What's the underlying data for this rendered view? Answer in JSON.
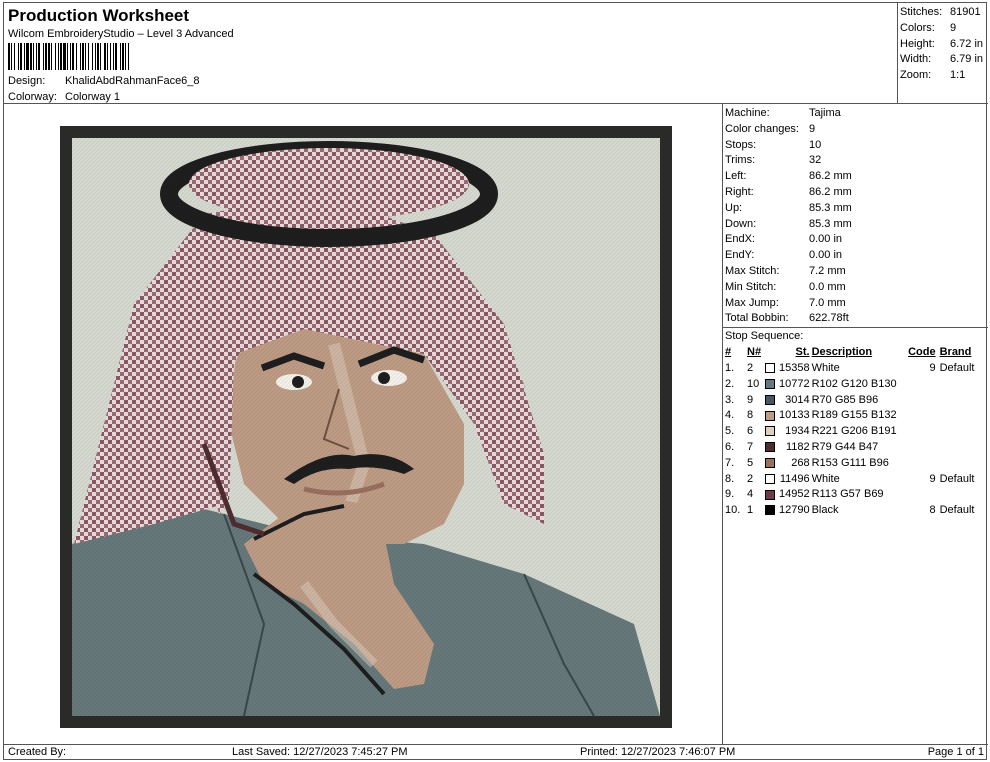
{
  "header": {
    "title": "Production Worksheet",
    "subtitle": "Wilcom EmbroideryStudio – Level 3 Advanced",
    "design_label": "Design:",
    "design_value": "KhalidAbdRahmanFace6_8",
    "colorway_label": "Colorway:",
    "colorway_value": "Colorway 1"
  },
  "stats": [
    {
      "label": "Stitches:",
      "value": "81901"
    },
    {
      "label": "Colors:",
      "value": "9"
    },
    {
      "label": "Height:",
      "value": "6.72 in"
    },
    {
      "label": "Width:",
      "value": "6.79 in"
    },
    {
      "label": "Zoom:",
      "value": "1:1"
    }
  ],
  "machine_info": [
    {
      "label": "Machine:",
      "value": "Tajima"
    },
    {
      "label": "Color changes:",
      "value": "9"
    },
    {
      "label": "Stops:",
      "value": "10"
    },
    {
      "label": "Trims:",
      "value": "32"
    },
    {
      "label": "Left:",
      "value": "86.2 mm"
    },
    {
      "label": "Right:",
      "value": "86.2 mm"
    },
    {
      "label": "Up:",
      "value": "85.3 mm"
    },
    {
      "label": "Down:",
      "value": "85.3 mm"
    },
    {
      "label": "EndX:",
      "value": "0.00 in"
    },
    {
      "label": "EndY:",
      "value": "0.00 in"
    },
    {
      "label": "Max Stitch:",
      "value": "7.2 mm"
    },
    {
      "label": "Min Stitch:",
      "value": "0.0 mm"
    },
    {
      "label": "Max Jump:",
      "value": "7.0 mm"
    },
    {
      "label": "Total Bobbin:",
      "value": "622.78ft"
    }
  ],
  "stop_sequence": {
    "title": "Stop Sequence:",
    "headers": {
      "num": "#",
      "n": "N#",
      "st": "St.",
      "desc": "Description",
      "code": "Code",
      "brand": "Brand"
    },
    "rows": [
      {
        "num": "1.",
        "n": "2",
        "color": "#ffffff",
        "st": "15358",
        "desc": "White",
        "code": "9",
        "brand": "Default"
      },
      {
        "num": "2.",
        "n": "10",
        "color": "#667882",
        "st": "10772",
        "desc": "R102 G120 B130",
        "code": "",
        "brand": ""
      },
      {
        "num": "3.",
        "n": "9",
        "color": "#465560",
        "st": "3014",
        "desc": "R70 G85 B96",
        "code": "",
        "brand": ""
      },
      {
        "num": "4.",
        "n": "8",
        "color": "#bd9b84",
        "st": "10133",
        "desc": "R189 G155 B132",
        "code": "",
        "brand": ""
      },
      {
        "num": "5.",
        "n": "6",
        "color": "#ddcebf",
        "st": "1934",
        "desc": "R221 G206 B191",
        "code": "",
        "brand": ""
      },
      {
        "num": "6.",
        "n": "7",
        "color": "#4f2c2f",
        "st": "1182",
        "desc": "R79 G44 B47",
        "code": "",
        "brand": ""
      },
      {
        "num": "7.",
        "n": "5",
        "color": "#996f60",
        "st": "268",
        "desc": "R153 G111 B96",
        "code": "",
        "brand": ""
      },
      {
        "num": "8.",
        "n": "2",
        "color": "#ffffff",
        "st": "11496",
        "desc": "White",
        "code": "9",
        "brand": "Default"
      },
      {
        "num": "9.",
        "n": "4",
        "color": "#713945",
        "st": "14952",
        "desc": "R113 G57 B69",
        "code": "",
        "brand": ""
      },
      {
        "num": "10.",
        "n": "1",
        "color": "#000000",
        "st": "12790",
        "desc": "Black",
        "code": "8",
        "brand": "Default"
      }
    ]
  },
  "footer": {
    "created_by": "Created By:",
    "last_saved": "Last Saved: 12/27/2023 7:45:27 PM",
    "printed": "Printed: 12/27/2023 7:46:07 PM",
    "page": "Page 1 of 1"
  },
  "colors": {
    "frame": "#2a2a28",
    "background": "#d5d9cf",
    "shirt": "#66787a",
    "skin": "#bd9b84",
    "headscarf_red": "#8a5a64",
    "agal": "#1e1e1e"
  }
}
